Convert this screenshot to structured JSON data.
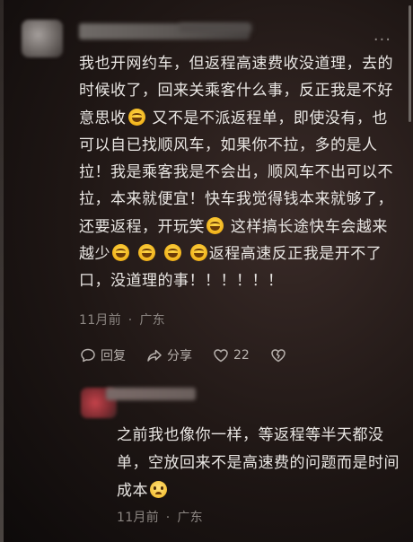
{
  "comment": {
    "more_label": "···",
    "text_1": "我也开网约车，但返程高速费收没道理，去的时候收了，回来关乘客什么事，反正我是不好意思收",
    "text_2": "又不是不派返程单，即使没有，也可以自已找顺风车，如果你不拉，多的是人拉！我是乘客我是不会出，顺风车不出可以不拉，本来就便宜！快车我觉得钱本来就够了，还要返程，开玩笑",
    "text_3": "这样搞长途快车会越来越少",
    "text_4": "返程高速反正我是开不了口，没道理的事！！！！！！",
    "emoji_names": [
      "laugh-cry-icon",
      "laugh-cry-icon",
      "laugh-cry-icon",
      "laugh-cry-icon",
      "laugh-cry-icon",
      "laugh-cry-icon"
    ],
    "time": "11月前",
    "location": "广东",
    "separator": "·",
    "actions": {
      "reply_label": "回复",
      "share_label": "分享",
      "like_count": "22"
    }
  },
  "reply": {
    "text": "之前我也像你一样，等返程等半天都没单，空放回来不是高速费的问题而是时间成本",
    "emoji_name": "worried-face-icon",
    "time": "11月前",
    "location": "广东",
    "separator": "·"
  },
  "colors": {
    "text": "#e9e6e3",
    "meta": "#8c8682",
    "emoji": "#f1b31c"
  }
}
